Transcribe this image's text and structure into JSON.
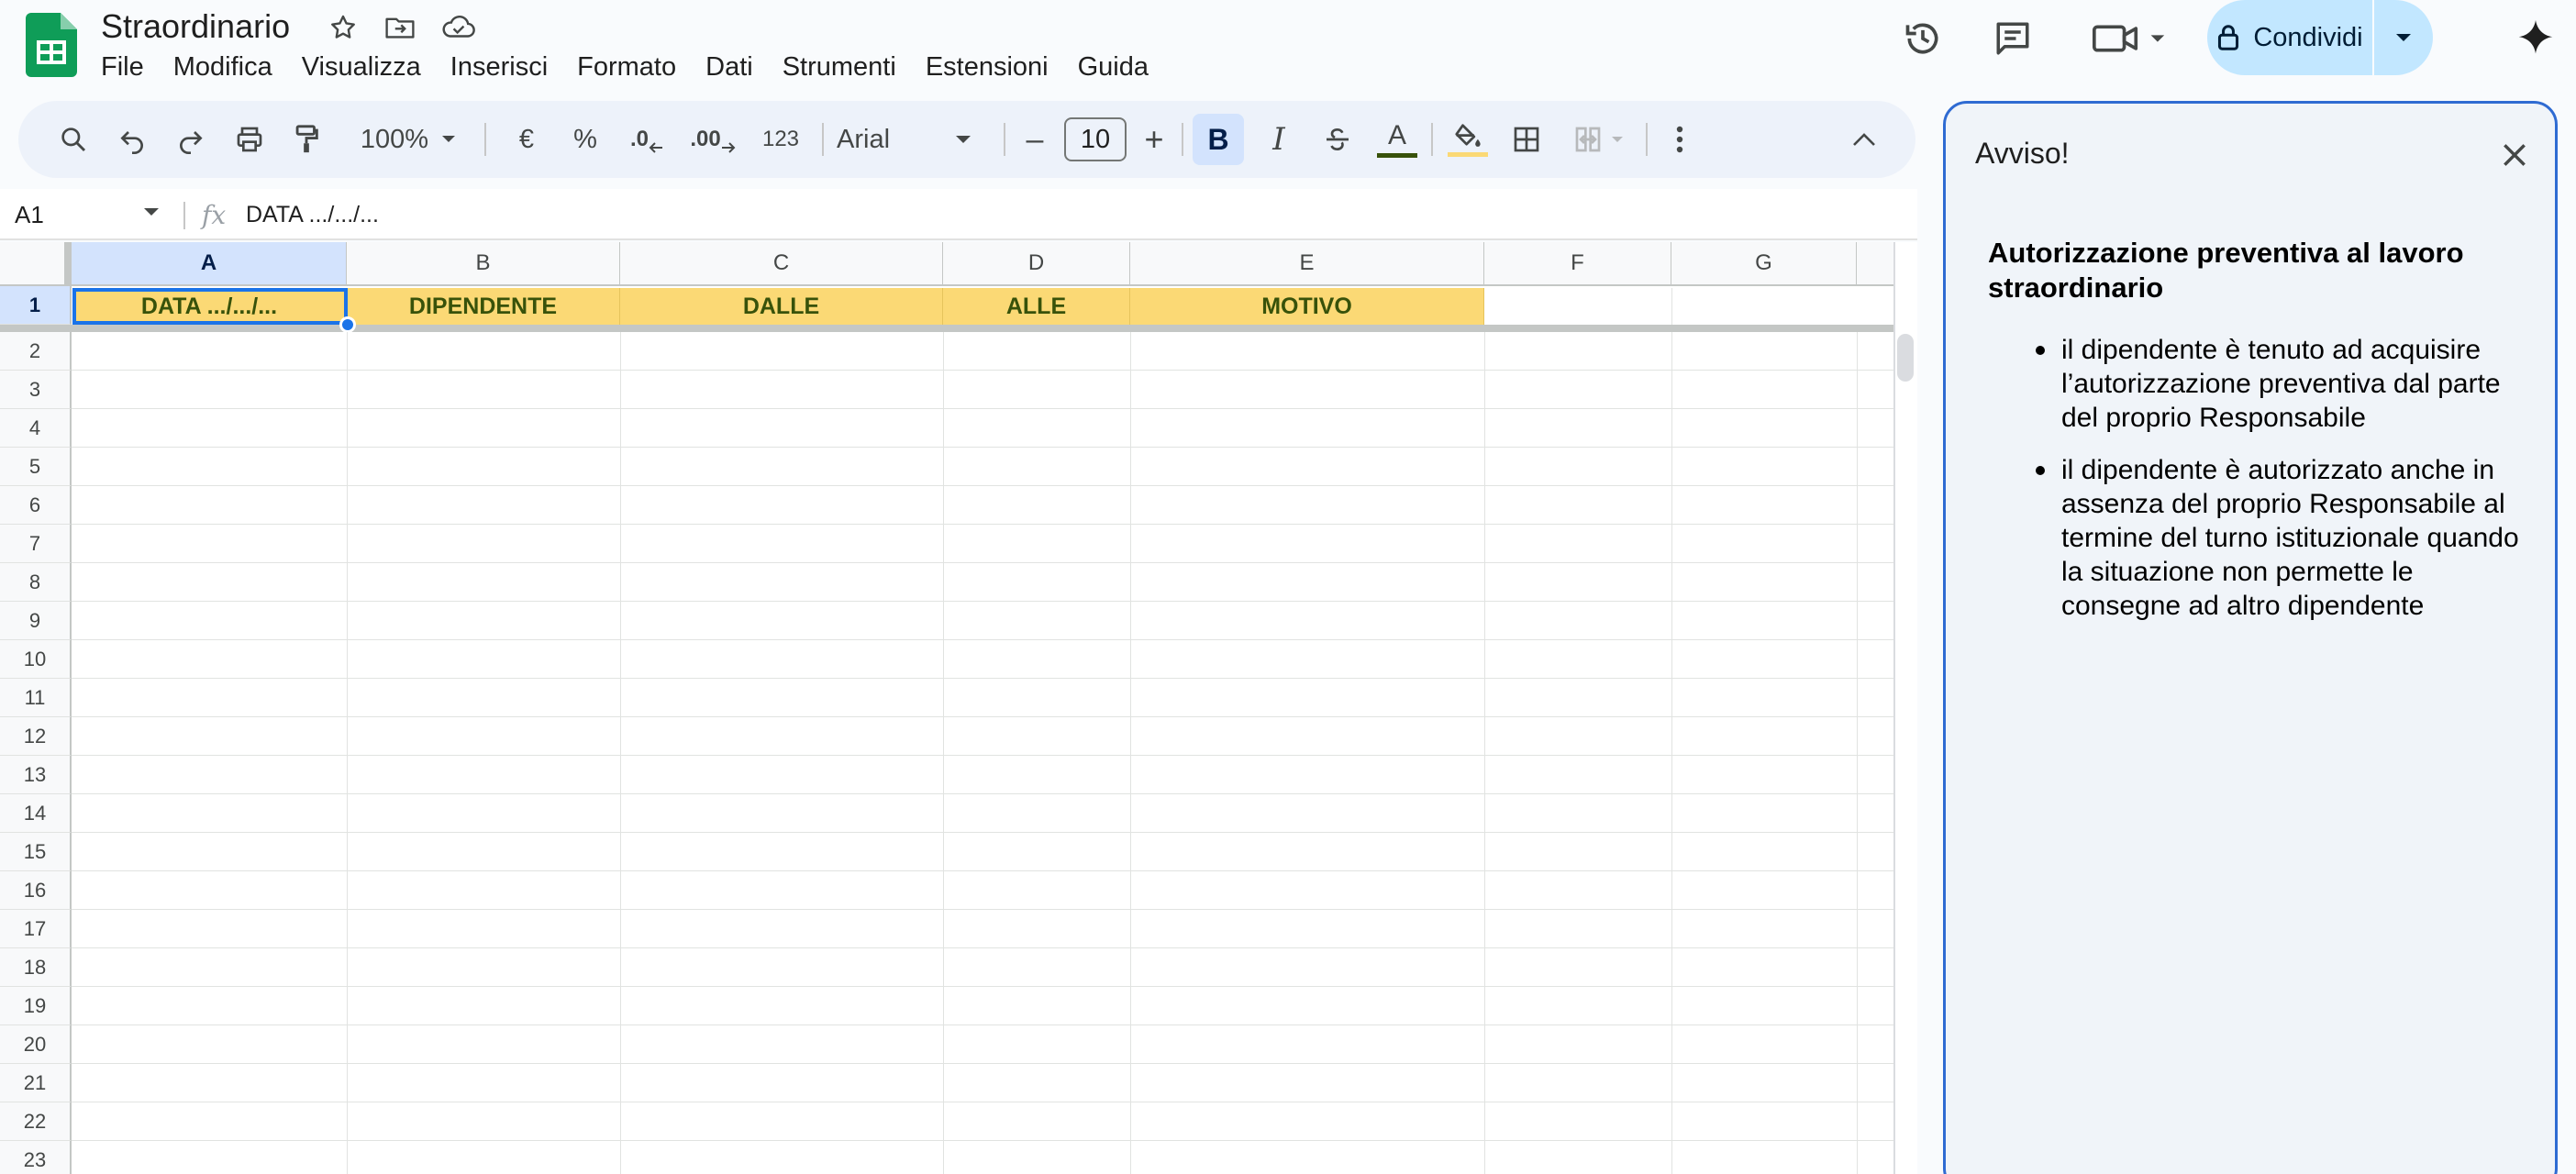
{
  "app": {
    "doc_title": "Straordinario",
    "menu": [
      "File",
      "Modifica",
      "Visualizza",
      "Inserisci",
      "Formato",
      "Dati",
      "Strumenti",
      "Estensioni",
      "Guida"
    ],
    "share_label": "Condividi"
  },
  "toolbar": {
    "zoom": "100%",
    "currency": "€",
    "percent": "%",
    "decrease_decimals": ".0",
    "increase_decimals": ".00",
    "number_format": "123",
    "font": "Arial",
    "font_size": "10",
    "minus": "–",
    "plus": "+",
    "bold": "B",
    "italic": "I",
    "text_color": "A"
  },
  "formula_bar": {
    "cell_ref": "A1",
    "fx": "fx",
    "value": "DATA .../.../..."
  },
  "sheet": {
    "columns": [
      "A",
      "B",
      "C",
      "D",
      "E",
      "F",
      "G"
    ],
    "rows": [
      "1",
      "2",
      "3",
      "4",
      "5",
      "6",
      "7",
      "8",
      "9",
      "10",
      "11",
      "12",
      "13",
      "14",
      "15",
      "16",
      "17",
      "18",
      "19",
      "20",
      "21",
      "22",
      "23"
    ],
    "header_row": [
      "DATA .../.../...",
      "DIPENDENTE",
      "DALLE",
      "ALLE",
      "MOTIVO"
    ],
    "header_fill": "#fbd975",
    "header_text_color": "#38520a",
    "selected_cell": "A1"
  },
  "panel": {
    "title": "Avviso!",
    "heading": "Autorizzazione preventiva al lavoro straordinario",
    "bullets": [
      "il dipendente è tenuto ad acquisire l’autorizzazione preventiva dal parte del proprio Responsabile",
      "il dipendente è autorizzato anche in assenza del proprio Responsabile al termine del turno istituzionale quando la situazione non permette le consegne ad altro dipendente"
    ]
  },
  "colors": {
    "accent": "#1a73e8",
    "share_bg": "#c2e7ff",
    "toolbar_bg": "#edf2fa",
    "panel_bg": "#f0f4f9"
  }
}
